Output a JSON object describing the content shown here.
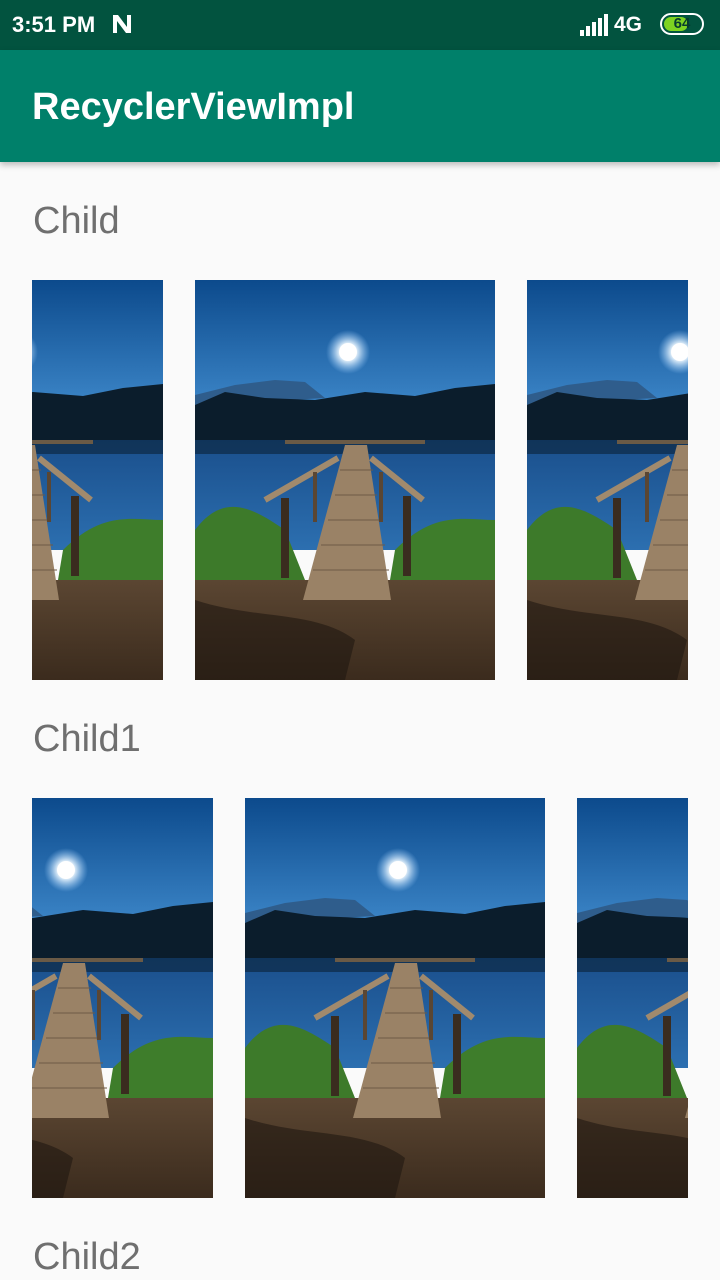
{
  "status_bar": {
    "time": "3:51 PM",
    "network": "4G",
    "battery": "64",
    "icons": [
      "n-notification-icon",
      "signal-icon",
      "battery-icon"
    ]
  },
  "app_bar": {
    "title": "RecyclerViewImpl",
    "color": "#00806a"
  },
  "sections": [
    {
      "label": "Child",
      "item_count": 3
    },
    {
      "label": "Child1",
      "item_count": 3
    },
    {
      "label": "Child2"
    }
  ],
  "image": {
    "description": "lake dock"
  }
}
